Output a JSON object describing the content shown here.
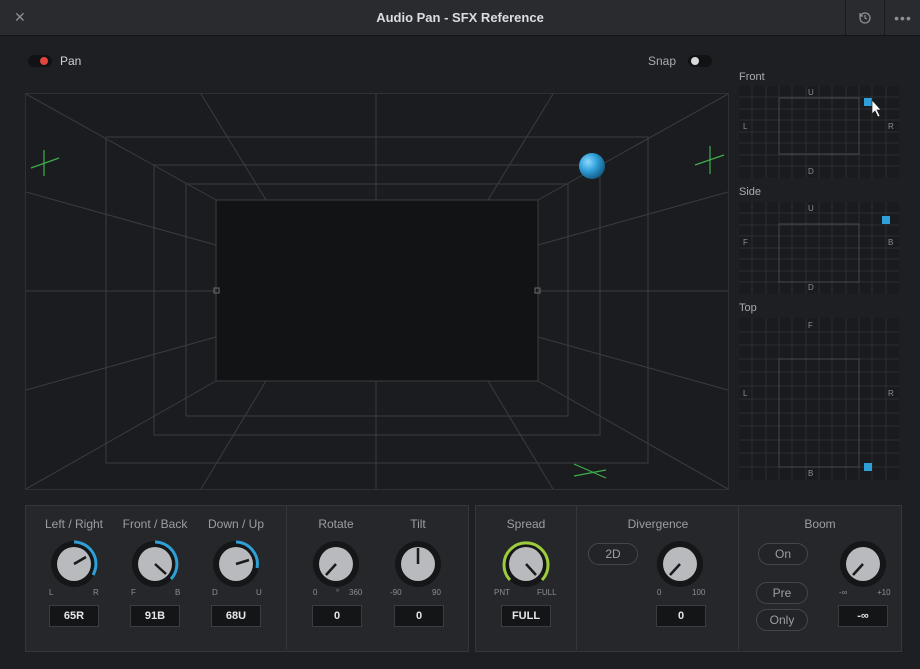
{
  "window": {
    "title": "Audio Pan - SFX Reference",
    "close_glyph": "✕",
    "more_glyph": "•••"
  },
  "toolbar": {
    "pan_label": "Pan",
    "pan_on": true,
    "snap_label": "Snap",
    "snap_on": false
  },
  "minimaps": {
    "front": {
      "title": "Front",
      "top": "U",
      "bottom": "D",
      "left": "L",
      "right": "R"
    },
    "side": {
      "title": "Side",
      "top": "U",
      "bottom": "D",
      "left": "F",
      "right": "B"
    },
    "top": {
      "title": "Top",
      "top": "F",
      "bottom": "B",
      "left": "L",
      "right": "R"
    }
  },
  "controls": {
    "left_right": {
      "label": "Left / Right",
      "min": "L",
      "max": "R",
      "value": "65R"
    },
    "front_back": {
      "label": "Front / Back",
      "min": "F",
      "max": "B",
      "value": "91B"
    },
    "down_up": {
      "label": "Down / Up",
      "min": "D",
      "max": "U",
      "value": "68U"
    },
    "rotate": {
      "label": "Rotate",
      "min": "0",
      "unit": "°",
      "max": "360",
      "value": "0"
    },
    "tilt": {
      "label": "Tilt",
      "min": "-90",
      "max": "90",
      "value": "0"
    },
    "spread": {
      "label": "Spread",
      "min": "PNT",
      "max": "FULL",
      "value": "FULL"
    },
    "divergence": {
      "label": "Divergence",
      "mode": "2D",
      "min": "0",
      "max": "100",
      "value": "0"
    },
    "boom": {
      "label": "Boom",
      "on_label": "On",
      "pre_label": "Pre",
      "only_label": "Only",
      "min": "-∞",
      "max": "+10",
      "value": "-∞"
    }
  },
  "colors": {
    "accent_blue": "#2f9fd8",
    "spread_green": "#9ccc3c",
    "pan_red": "#e0463c",
    "marker_green": "#3fae4a"
  },
  "icons": [
    "close-icon",
    "reset-icon",
    "more-icon",
    "cursor-icon",
    "speaker-marker-icon"
  ]
}
